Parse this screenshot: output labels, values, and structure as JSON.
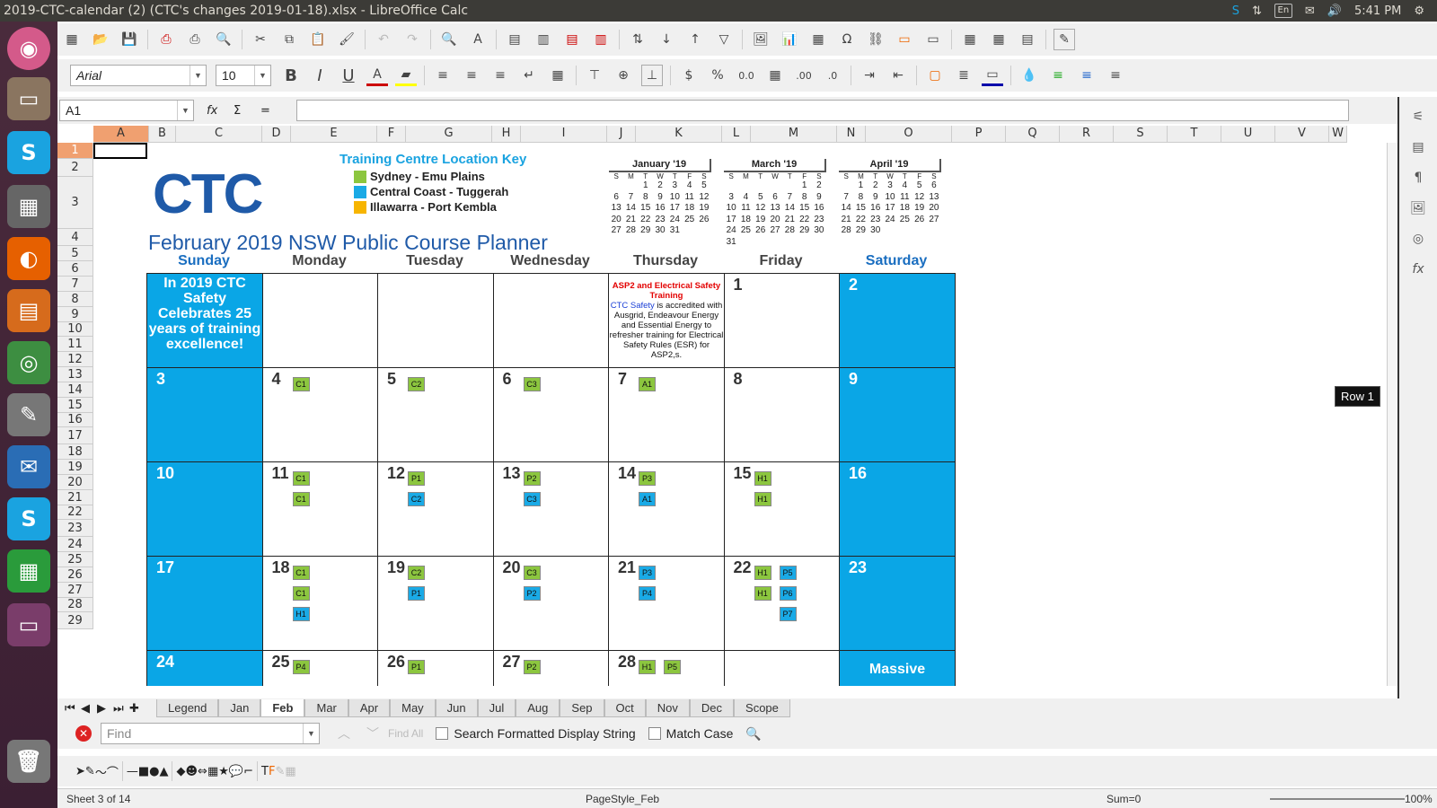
{
  "window_title": "2019-CTC-calendar (2) (CTC's changes 2019-01-18).xlsx - LibreOffice Calc",
  "tray": {
    "lang": "En",
    "time": "5:41 PM"
  },
  "toolbar": {
    "font_name": "Arial",
    "font_size": "10"
  },
  "formula": {
    "cell_ref": "A1",
    "value": ""
  },
  "columns": [
    "A",
    "B",
    "C",
    "D",
    "E",
    "F",
    "G",
    "H",
    "I",
    "J",
    "K",
    "L",
    "M",
    "N",
    "O",
    "P",
    "Q",
    "R",
    "S",
    "T",
    "U",
    "V",
    "W"
  ],
  "rows": [
    "1",
    "2",
    "3",
    "4",
    "5",
    "6",
    "7",
    "8",
    "9",
    "10",
    "11",
    "12",
    "13",
    "14",
    "15",
    "16",
    "17",
    "18",
    "19",
    "20",
    "21",
    "22",
    "23",
    "24",
    "25",
    "26",
    "27",
    "28",
    "29"
  ],
  "logo_text": "CTC",
  "key": {
    "title": "Training Centre Location Key",
    "items": [
      {
        "label": "Sydney - Emu Plains",
        "color": "#8cc63f"
      },
      {
        "label": "Central Coast - Tuggerah",
        "color": "#1aaae6"
      },
      {
        "label": "Illawarra - Port Kembla",
        "color": "#f7b500"
      }
    ]
  },
  "mini_calendars": [
    {
      "title": "January '19",
      "dows": [
        "S",
        "M",
        "T",
        "W",
        "T",
        "F",
        "S"
      ],
      "days": [
        "",
        "",
        "1",
        "2",
        "3",
        "4",
        "5",
        "6",
        "7",
        "8",
        "9",
        "10",
        "11",
        "12",
        "13",
        "14",
        "15",
        "16",
        "17",
        "18",
        "19",
        "20",
        "21",
        "22",
        "23",
        "24",
        "25",
        "26",
        "27",
        "28",
        "29",
        "30",
        "31",
        "",
        ""
      ]
    },
    {
      "title": "March '19",
      "dows": [
        "S",
        "M",
        "T",
        "W",
        "T",
        "F",
        "S"
      ],
      "days": [
        "",
        "",
        "",
        "",
        "",
        "1",
        "2",
        "3",
        "4",
        "5",
        "6",
        "7",
        "8",
        "9",
        "10",
        "11",
        "12",
        "13",
        "14",
        "15",
        "16",
        "17",
        "18",
        "19",
        "20",
        "21",
        "22",
        "23",
        "24",
        "25",
        "26",
        "27",
        "28",
        "29",
        "30",
        "31",
        "",
        "",
        "",
        "",
        "",
        ""
      ]
    },
    {
      "title": "April '19",
      "dows": [
        "S",
        "M",
        "T",
        "W",
        "T",
        "F",
        "S"
      ],
      "days": [
        "",
        "1",
        "2",
        "3",
        "4",
        "5",
        "6",
        "7",
        "8",
        "9",
        "10",
        "11",
        "12",
        "13",
        "14",
        "15",
        "16",
        "17",
        "18",
        "19",
        "20",
        "21",
        "22",
        "23",
        "24",
        "25",
        "26",
        "27",
        "28",
        "29",
        "30",
        "",
        "",
        "",
        ""
      ]
    }
  ],
  "planner_title": "February 2019 NSW Public Course Planner",
  "day_headers": [
    "Sunday",
    "Monday",
    "Tuesday",
    "Wednesday",
    "Thursday",
    "Friday",
    "Saturday"
  ],
  "promo_text": "In 2019 CTC Safety Celebrates 25 years of training excellence!",
  "note": {
    "heading": "ASP2 and Electrical Safety Training",
    "org": "CTC Safety",
    "body": "is accredited with Ausgrid, Endeavour Energy and Essential Energy to refresher training for Electrical Safety Rules (ESR) for ASP2,s."
  },
  "weeks": [
    [
      {
        "d": ""
      },
      {
        "d": ""
      },
      {
        "d": ""
      },
      {
        "d": ""
      },
      {
        "d": ""
      },
      {
        "d": "1"
      },
      {
        "d": "2"
      }
    ],
    [
      {
        "d": "3"
      },
      {
        "d": "4",
        "b": [
          [
            "C1",
            "g",
            0,
            0
          ]
        ]
      },
      {
        "d": "5",
        "b": [
          [
            "C2",
            "g",
            0,
            0
          ]
        ]
      },
      {
        "d": "6",
        "b": [
          [
            "C3",
            "g",
            0,
            0
          ]
        ]
      },
      {
        "d": "7",
        "b": [
          [
            "A1",
            "g",
            0,
            0
          ]
        ]
      },
      {
        "d": "8"
      },
      {
        "d": "9"
      }
    ],
    [
      {
        "d": "10"
      },
      {
        "d": "11",
        "b": [
          [
            "C1",
            "g",
            0,
            0
          ],
          [
            "C1",
            "g",
            0,
            1
          ]
        ]
      },
      {
        "d": "12",
        "b": [
          [
            "P1",
            "g",
            0,
            0
          ],
          [
            "C2",
            "b",
            0,
            1
          ]
        ]
      },
      {
        "d": "13",
        "b": [
          [
            "P2",
            "g",
            0,
            0
          ],
          [
            "C3",
            "b",
            0,
            1
          ]
        ]
      },
      {
        "d": "14",
        "b": [
          [
            "P3",
            "g",
            0,
            0
          ],
          [
            "A1",
            "b",
            0,
            1
          ]
        ]
      },
      {
        "d": "15",
        "b": [
          [
            "H1",
            "g",
            0,
            0
          ],
          [
            "H1",
            "g",
            0,
            1
          ]
        ]
      },
      {
        "d": "16"
      }
    ],
    [
      {
        "d": "17"
      },
      {
        "d": "18",
        "b": [
          [
            "C1",
            "g",
            0,
            0
          ],
          [
            "C1",
            "g",
            0,
            1
          ],
          [
            "H1",
            "b",
            0,
            2
          ]
        ]
      },
      {
        "d": "19",
        "b": [
          [
            "C2",
            "g",
            0,
            0
          ],
          [
            "P1",
            "b",
            0,
            1
          ]
        ]
      },
      {
        "d": "20",
        "b": [
          [
            "C3",
            "g",
            0,
            0
          ],
          [
            "P2",
            "b",
            0,
            1
          ]
        ]
      },
      {
        "d": "21",
        "b": [
          [
            "P3",
            "b",
            0,
            0
          ],
          [
            "P4",
            "b",
            0,
            1
          ]
        ]
      },
      {
        "d": "22",
        "b": [
          [
            "H1",
            "g",
            0,
            0
          ],
          [
            "P5",
            "b",
            1,
            0
          ],
          [
            "H1",
            "g",
            0,
            1
          ],
          [
            "P6",
            "b",
            1,
            1
          ],
          [
            "P7",
            "b",
            1,
            2
          ]
        ]
      },
      {
        "d": "23"
      }
    ],
    [
      {
        "d": "24"
      },
      {
        "d": "25",
        "b": [
          [
            "P4",
            "g",
            0,
            0
          ]
        ]
      },
      {
        "d": "26",
        "b": [
          [
            "P1",
            "g",
            0,
            0
          ]
        ]
      },
      {
        "d": "27",
        "b": [
          [
            "P2",
            "g",
            0,
            0
          ]
        ]
      },
      {
        "d": "28",
        "b": [
          [
            "H1",
            "g",
            0,
            0
          ],
          [
            "P5",
            "g",
            1,
            0
          ]
        ]
      },
      {
        "d": ""
      },
      {
        "d": "Massive"
      }
    ]
  ],
  "tabs": [
    "Legend",
    "Jan",
    "Feb",
    "Mar",
    "Apr",
    "May",
    "Jun",
    "Jul",
    "Aug",
    "Sep",
    "Oct",
    "Nov",
    "Dec",
    "Scope"
  ],
  "active_tab": "Feb",
  "find": {
    "placeholder": "Find",
    "find_all": "Find All",
    "opt1": "Search Formatted Display String",
    "opt2": "Match Case"
  },
  "status": {
    "sheet": "Sheet 3 of 14",
    "page_style": "PageStyle_Feb",
    "sum": "Sum=0",
    "zoom": "100%"
  },
  "tooltip": "Row 1"
}
